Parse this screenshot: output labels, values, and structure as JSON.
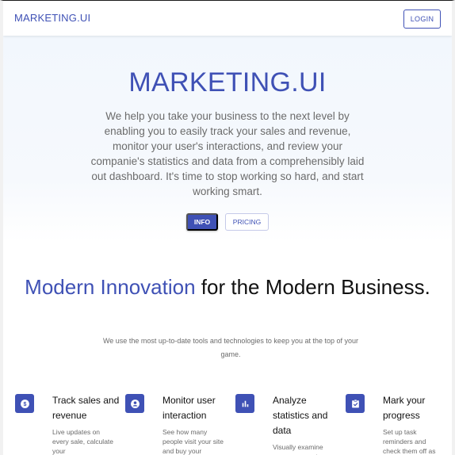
{
  "header": {
    "brand": "MARKETING.UI",
    "login_label": "LOGIN"
  },
  "hero": {
    "title": "MARKETING.UI",
    "description": "We help you take your business to the next level by enabling you to easily track your sales and revenue, monitor your user's interactions, and review your companie's statistics and data from a comprehensibly laid out dashboard. It's time to stop working so hard, and start working smart.",
    "info_label": "INFO",
    "pricing_label": "PRICING"
  },
  "section": {
    "title_accent": "Modern Innovation",
    "title_rest": "for the Modern Business.",
    "subtitle": "We use the most up-to-date tools and technologies to keep you at the top of your game."
  },
  "features": [
    {
      "icon": "dollar-icon",
      "title": "Track sales and revenue",
      "description": "Live updates on every sale, calculate your"
    },
    {
      "icon": "user-icon",
      "title": "Monitor user interaction",
      "description": "See how many people visit your site and buy your"
    },
    {
      "icon": "bar-chart-icon",
      "title": "Analyze statistics and data",
      "description": "Visually examine your progress to"
    },
    {
      "icon": "task-check-icon",
      "title": "Mark your progress",
      "description": "Set up task reminders and check them off as"
    }
  ],
  "colors": {
    "primary": "#3f51b5",
    "hero_background": "#f2f7fd",
    "muted_text": "#6b6b6b"
  }
}
